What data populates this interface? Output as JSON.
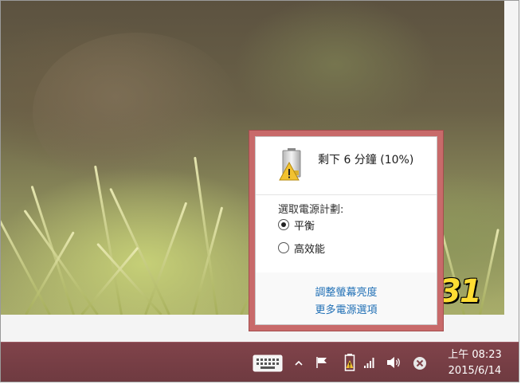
{
  "flyout": {
    "battery_status": "剩下 6 分鐘 (10%)",
    "plan_label": "選取電源計劃:",
    "plans": [
      {
        "label": "平衡",
        "selected": true
      },
      {
        "label": "高效能",
        "selected": false
      }
    ],
    "links": {
      "adjust_brightness": "調整螢幕亮度",
      "more_options": "更多電源選項"
    },
    "border_color": "#c86a6a"
  },
  "taskbar": {
    "color": "#80434a",
    "tray_icons": [
      "keyboard-icon",
      "chevron-up-icon",
      "flag-icon",
      "battery-warning-icon",
      "signal-icon",
      "volume-icon",
      "close-circle-icon"
    ],
    "clock": {
      "time": "上午 08:23",
      "date": "2015/6/14"
    }
  },
  "wallpaper": {
    "logo_text": "31"
  }
}
